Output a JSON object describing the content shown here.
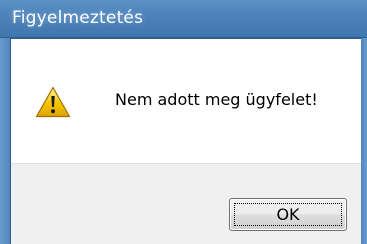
{
  "window": {
    "title": "Figyelmeztetés"
  },
  "message": {
    "text": "Nem adott meg ügyfelet!",
    "icon": "warning-icon"
  },
  "buttons": {
    "ok_label": "OK"
  },
  "colors": {
    "titlebar": "#4b82ba",
    "content_bg": "#ffffff",
    "footer_bg": "#f0f0f0",
    "warning_yellow": "#f5c400"
  }
}
